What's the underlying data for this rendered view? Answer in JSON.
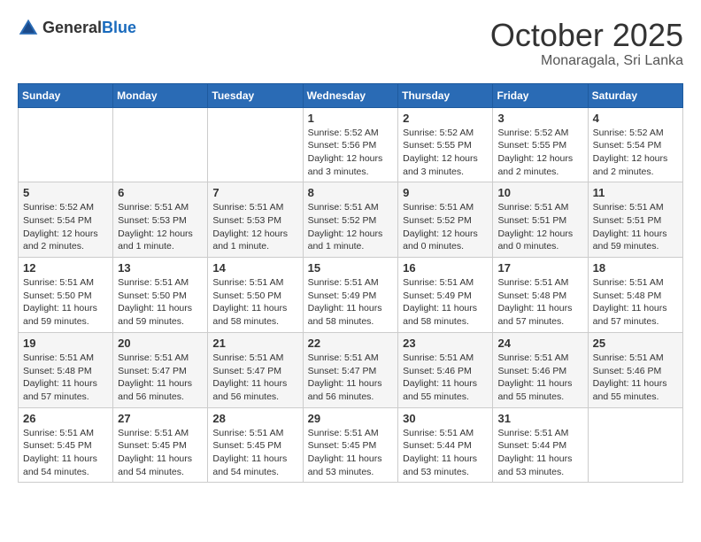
{
  "header": {
    "logo_general": "General",
    "logo_blue": "Blue",
    "month": "October 2025",
    "location": "Monaragala, Sri Lanka"
  },
  "weekdays": [
    "Sunday",
    "Monday",
    "Tuesday",
    "Wednesday",
    "Thursday",
    "Friday",
    "Saturday"
  ],
  "weeks": [
    [
      {
        "day": "",
        "text": ""
      },
      {
        "day": "",
        "text": ""
      },
      {
        "day": "",
        "text": ""
      },
      {
        "day": "1",
        "text": "Sunrise: 5:52 AM\nSunset: 5:56 PM\nDaylight: 12 hours and 3 minutes."
      },
      {
        "day": "2",
        "text": "Sunrise: 5:52 AM\nSunset: 5:55 PM\nDaylight: 12 hours and 3 minutes."
      },
      {
        "day": "3",
        "text": "Sunrise: 5:52 AM\nSunset: 5:55 PM\nDaylight: 12 hours and 2 minutes."
      },
      {
        "day": "4",
        "text": "Sunrise: 5:52 AM\nSunset: 5:54 PM\nDaylight: 12 hours and 2 minutes."
      }
    ],
    [
      {
        "day": "5",
        "text": "Sunrise: 5:52 AM\nSunset: 5:54 PM\nDaylight: 12 hours and 2 minutes."
      },
      {
        "day": "6",
        "text": "Sunrise: 5:51 AM\nSunset: 5:53 PM\nDaylight: 12 hours and 1 minute."
      },
      {
        "day": "7",
        "text": "Sunrise: 5:51 AM\nSunset: 5:53 PM\nDaylight: 12 hours and 1 minute."
      },
      {
        "day": "8",
        "text": "Sunrise: 5:51 AM\nSunset: 5:52 PM\nDaylight: 12 hours and 1 minute."
      },
      {
        "day": "9",
        "text": "Sunrise: 5:51 AM\nSunset: 5:52 PM\nDaylight: 12 hours and 0 minutes."
      },
      {
        "day": "10",
        "text": "Sunrise: 5:51 AM\nSunset: 5:51 PM\nDaylight: 12 hours and 0 minutes."
      },
      {
        "day": "11",
        "text": "Sunrise: 5:51 AM\nSunset: 5:51 PM\nDaylight: 11 hours and 59 minutes."
      }
    ],
    [
      {
        "day": "12",
        "text": "Sunrise: 5:51 AM\nSunset: 5:50 PM\nDaylight: 11 hours and 59 minutes."
      },
      {
        "day": "13",
        "text": "Sunrise: 5:51 AM\nSunset: 5:50 PM\nDaylight: 11 hours and 59 minutes."
      },
      {
        "day": "14",
        "text": "Sunrise: 5:51 AM\nSunset: 5:50 PM\nDaylight: 11 hours and 58 minutes."
      },
      {
        "day": "15",
        "text": "Sunrise: 5:51 AM\nSunset: 5:49 PM\nDaylight: 11 hours and 58 minutes."
      },
      {
        "day": "16",
        "text": "Sunrise: 5:51 AM\nSunset: 5:49 PM\nDaylight: 11 hours and 58 minutes."
      },
      {
        "day": "17",
        "text": "Sunrise: 5:51 AM\nSunset: 5:48 PM\nDaylight: 11 hours and 57 minutes."
      },
      {
        "day": "18",
        "text": "Sunrise: 5:51 AM\nSunset: 5:48 PM\nDaylight: 11 hours and 57 minutes."
      }
    ],
    [
      {
        "day": "19",
        "text": "Sunrise: 5:51 AM\nSunset: 5:48 PM\nDaylight: 11 hours and 57 minutes."
      },
      {
        "day": "20",
        "text": "Sunrise: 5:51 AM\nSunset: 5:47 PM\nDaylight: 11 hours and 56 minutes."
      },
      {
        "day": "21",
        "text": "Sunrise: 5:51 AM\nSunset: 5:47 PM\nDaylight: 11 hours and 56 minutes."
      },
      {
        "day": "22",
        "text": "Sunrise: 5:51 AM\nSunset: 5:47 PM\nDaylight: 11 hours and 56 minutes."
      },
      {
        "day": "23",
        "text": "Sunrise: 5:51 AM\nSunset: 5:46 PM\nDaylight: 11 hours and 55 minutes."
      },
      {
        "day": "24",
        "text": "Sunrise: 5:51 AM\nSunset: 5:46 PM\nDaylight: 11 hours and 55 minutes."
      },
      {
        "day": "25",
        "text": "Sunrise: 5:51 AM\nSunset: 5:46 PM\nDaylight: 11 hours and 55 minutes."
      }
    ],
    [
      {
        "day": "26",
        "text": "Sunrise: 5:51 AM\nSunset: 5:45 PM\nDaylight: 11 hours and 54 minutes."
      },
      {
        "day": "27",
        "text": "Sunrise: 5:51 AM\nSunset: 5:45 PM\nDaylight: 11 hours and 54 minutes."
      },
      {
        "day": "28",
        "text": "Sunrise: 5:51 AM\nSunset: 5:45 PM\nDaylight: 11 hours and 54 minutes."
      },
      {
        "day": "29",
        "text": "Sunrise: 5:51 AM\nSunset: 5:45 PM\nDaylight: 11 hours and 53 minutes."
      },
      {
        "day": "30",
        "text": "Sunrise: 5:51 AM\nSunset: 5:44 PM\nDaylight: 11 hours and 53 minutes."
      },
      {
        "day": "31",
        "text": "Sunrise: 5:51 AM\nSunset: 5:44 PM\nDaylight: 11 hours and 53 minutes."
      },
      {
        "day": "",
        "text": ""
      }
    ]
  ]
}
